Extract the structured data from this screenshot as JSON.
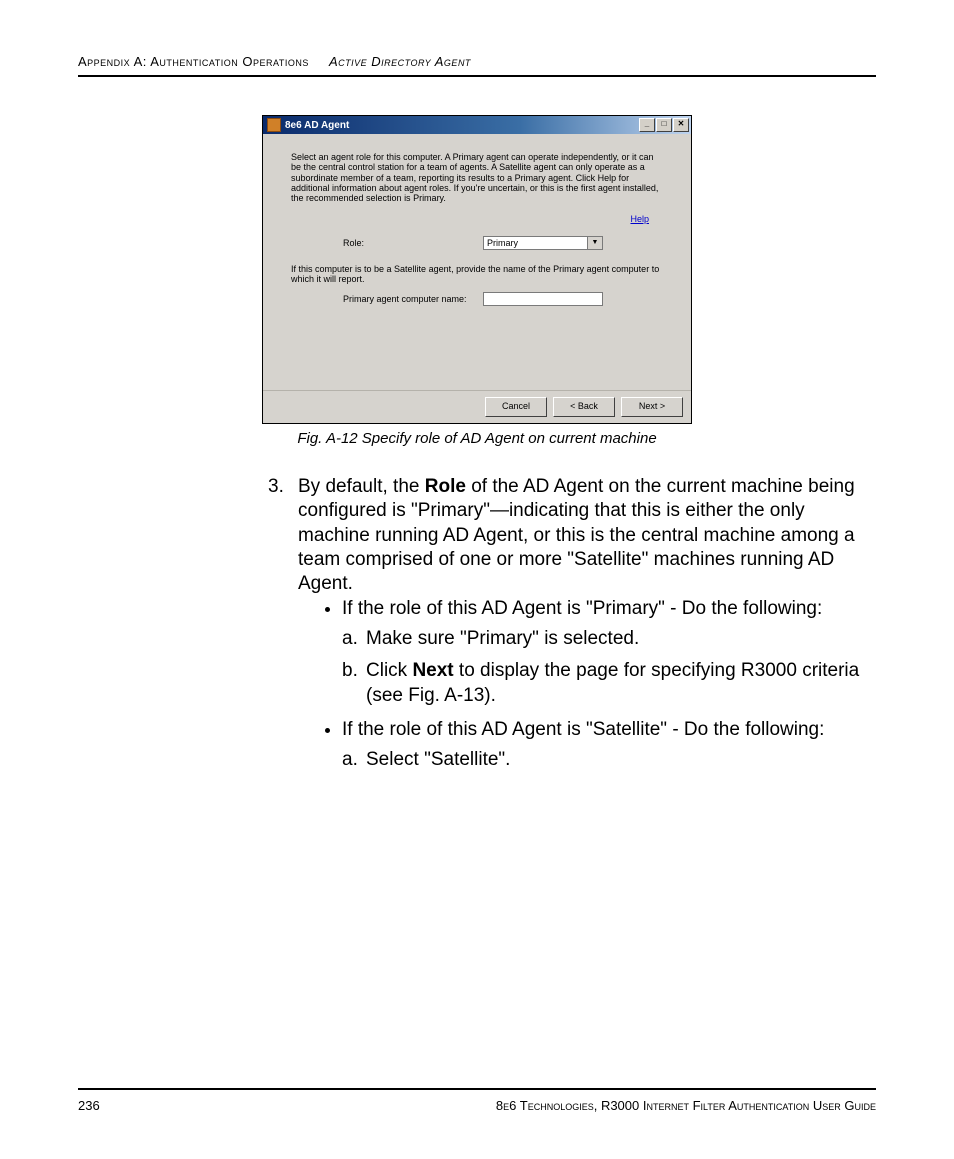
{
  "header": {
    "left": "Appendix A: Authentication Operations",
    "right": "Active Directory Agent"
  },
  "dialog": {
    "title": "8e6 AD Agent",
    "description": "Select an agent role for this computer. A Primary agent can operate independently, or it can be the central control station for a team of agents. A Satellite agent can only operate as a subordinate member of a team, reporting its results to a Primary agent. Click Help for additional information about agent roles. If you're uncertain, or this is the first agent installed, the recommended selection is Primary.",
    "help": "Help",
    "role_label": "Role:",
    "role_value": "Primary",
    "satellite_note": "If this computer is to be a Satellite agent, provide the name of the Primary agent computer to which it will report.",
    "primary_label": "Primary agent computer name:",
    "primary_value": "",
    "btn_cancel": "Cancel",
    "btn_back": "< Back",
    "btn_next": "Next >"
  },
  "caption": "Fig. A-12  Specify role of AD Agent on current machine",
  "body": {
    "list_number": "3.",
    "para_pre": "By default, the ",
    "para_bold1": "Role",
    "para_post": " of the AD Agent on the current machine being configured is \"Primary\"—indicating that this is either the only machine running AD Agent, or this is the central machine among a team comprised of one or more \"Satellite\" machines running AD Agent.",
    "bullet1": "If the role of this AD Agent is \"Primary\" - Do the following:",
    "b1_a": "Make sure \"Primary\" is selected.",
    "b1_b_pre": "Click ",
    "b1_b_bold": "Next",
    "b1_b_post": " to display the page for specifying R3000 criteria (see Fig. A-13).",
    "bullet2": "If the role of this AD Agent is \"Satellite\" - Do the following:",
    "b2_a": "Select \"Satellite\"."
  },
  "footer": {
    "page": "236",
    "right": "8e6 Technologies, R3000 Internet Filter Authentication User Guide"
  }
}
